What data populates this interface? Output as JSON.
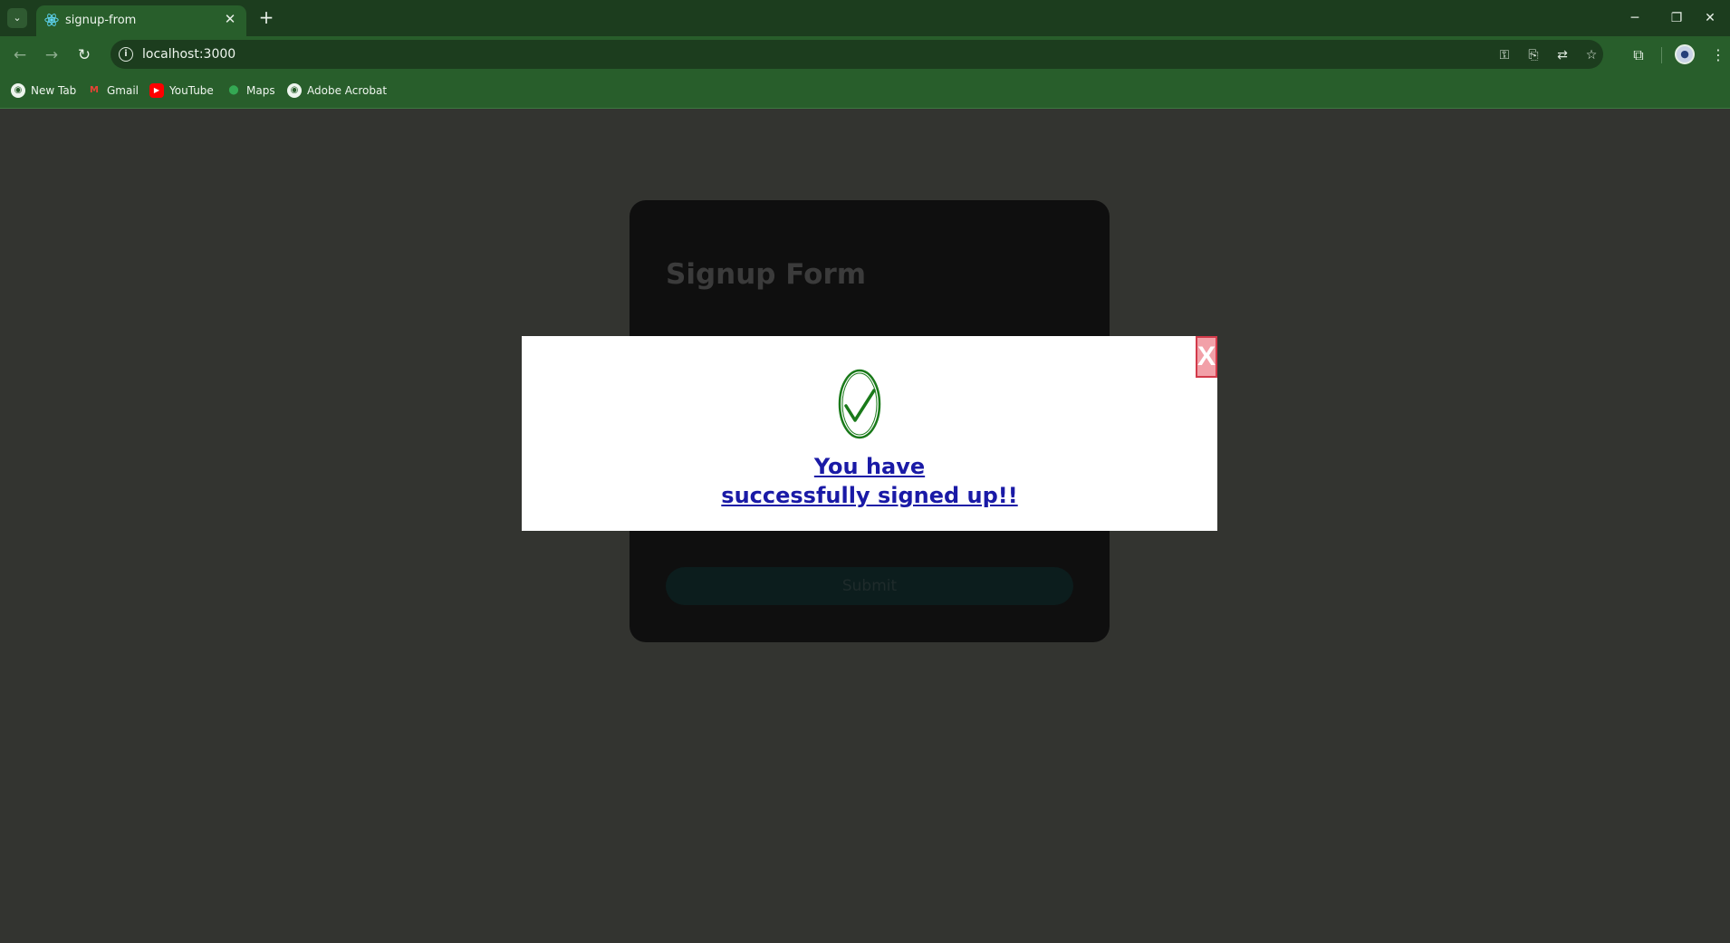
{
  "browser": {
    "tab_title": "signup-from",
    "url": "localhost:3000",
    "bookmarks": [
      {
        "label": "New Tab",
        "icon": "globe-icon"
      },
      {
        "label": "Gmail",
        "icon": "gmail-icon"
      },
      {
        "label": "YouTube",
        "icon": "youtube-icon"
      },
      {
        "label": "Maps",
        "icon": "maps-icon"
      },
      {
        "label": "Adobe Acrobat",
        "icon": "globe-icon"
      }
    ]
  },
  "form": {
    "title": "Signup Form",
    "submit_label": "Submit"
  },
  "modal": {
    "close_label": "X",
    "message_line1": "You have",
    "message_line2": "successfully signed up!!"
  },
  "colors": {
    "tabstrip": "#1c3d1e",
    "toolbar": "#285e2b",
    "page_bg": "#333430",
    "check": "#1a7a1a",
    "message": "#1a1aa6",
    "close_bg": "#f2a0a8"
  }
}
